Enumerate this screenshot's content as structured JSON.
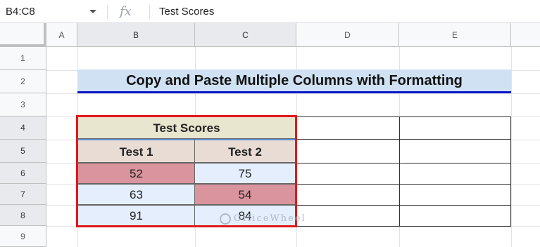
{
  "formula_bar": {
    "name_box": "B4:C8",
    "fx_label": "fx",
    "content": "Test Scores"
  },
  "column_headers": [
    "A",
    "B",
    "C",
    "D",
    "E"
  ],
  "row_headers": [
    "1",
    "2",
    "3",
    "4",
    "5",
    "6",
    "7",
    "8",
    "9"
  ],
  "sheet": {
    "title": "Copy and Paste Multiple Columns with Formatting",
    "table_title": "Test Scores",
    "col_labels": [
      "Test 1",
      "Test 2"
    ],
    "rows": [
      [
        "52",
        "75"
      ],
      [
        "63",
        "54"
      ],
      [
        "91",
        "84"
      ]
    ]
  },
  "colors": {
    "title_bg": "#cfe1f3",
    "title_underline": "#0b18c9",
    "table_title_bg": "#e8e6cf",
    "header_bg": "#e8dcd5",
    "highlight_pink": "#d9949d",
    "light_blue": "#e4eefc",
    "selection_border": "#e0181b"
  },
  "watermark": "OfficeWheel"
}
